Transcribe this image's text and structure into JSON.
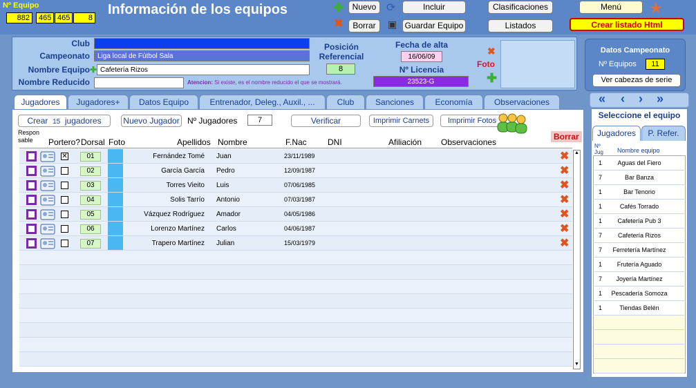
{
  "header": {
    "title": "Información de los equipos",
    "equipo_label": "Nº Equipo",
    "equipo_vals": [
      "882",
      "465",
      "465",
      "8"
    ]
  },
  "toolbar": {
    "nuevo": "Nuevo",
    "incluir": "Incluir",
    "clasificaciones": "Clasificaciones",
    "menu": "Menú",
    "borrar": "Borrar",
    "guardar": "Guardar Equipo",
    "listados": "Listados",
    "crear_html": "Crear listado Html"
  },
  "form": {
    "club_label": "Club",
    "club_value": "",
    "campeonato_label": "Campeonato",
    "campeonato_value": "Liga local de Fútbol Sala",
    "nombre_label": "Nombre Equipo",
    "nombre_value": "Cafetería Rizos",
    "reducido_label": "Nombre Reducido",
    "reducido_value": "",
    "atencion_bold": "Atencion:",
    "atencion_text": "Si existe, es el nombre reducido el que se mostrará.",
    "posicion_label": "Posición Referencial",
    "posicion_value": "8",
    "fecha_label": "Fecha de alta",
    "fecha_value": "16/06/09",
    "licencia_label": "Nº Licencia",
    "licencia_value": "23523-G",
    "foto_label": "Foto"
  },
  "campeonato_panel": {
    "title": "Datos Campeonato",
    "equipos_label": "Nº Equipos",
    "equipos_value": "11",
    "ver_cabezas": "Ver cabezas de serie"
  },
  "tabs": [
    "Jugadores",
    "Jugadores+",
    "Datos Equipo",
    "Entrenador, Deleg., Auxil., ...",
    "Club",
    "Sanciones",
    "Economía",
    "Observaciones"
  ],
  "players_toolbar": {
    "crear": "Crear",
    "crear_count": "15",
    "jugadores": "jugadores",
    "nuevo_jugador": "Nuevo Jugador",
    "n_jugadores_label": "Nº Jugadores",
    "n_jugadores_value": "7",
    "verificar": "Verificar",
    "imprimir_carnets": "Imprimir Carnets",
    "imprimir_fotos": "Imprimir Fotos",
    "borrar": "Borrar"
  },
  "columns": {
    "responsable": "Respon sable",
    "portero": "Portero?",
    "dorsal": "Dorsal",
    "foto": "Foto",
    "apellidos": "Apellidos",
    "nombre": "Nombre",
    "fnac": "F.Nac",
    "dni": "DNI",
    "afiliacion": "Afiliación",
    "observaciones": "Observaciones"
  },
  "players": [
    {
      "portero": true,
      "dorsal": "01",
      "apellidos": "Fernández Tomé",
      "nombre": "Juan",
      "fnac": "23/11/1989"
    },
    {
      "portero": false,
      "dorsal": "02",
      "apellidos": "García García",
      "nombre": "Pedro",
      "fnac": "12/09/1987"
    },
    {
      "portero": false,
      "dorsal": "03",
      "apellidos": "Torres Vieito",
      "nombre": "Luis",
      "fnac": "07/06/1985"
    },
    {
      "portero": false,
      "dorsal": "04",
      "apellidos": "Solis Tarrío",
      "nombre": "Antonio",
      "fnac": "07/03/1987"
    },
    {
      "portero": false,
      "dorsal": "05",
      "apellidos": "Vázquez Rodríguez",
      "nombre": "Amador",
      "fnac": "04/05/1986"
    },
    {
      "portero": false,
      "dorsal": "06",
      "apellidos": "Lorenzo Martínez",
      "nombre": "Carlos",
      "fnac": "04/06/1987"
    },
    {
      "portero": false,
      "dorsal": "07",
      "apellidos": "Trapero Martínez",
      "nombre": "Julian",
      "fnac": "15/03/1979"
    }
  ],
  "side": {
    "title": "Seleccione el equipo",
    "tab1": "Jugadores",
    "tab2": "P. Refer.",
    "col1": "Nº Jug",
    "col2": "Nombre equipo",
    "teams": [
      {
        "n": "1",
        "name": "Aguas del Fiero"
      },
      {
        "n": "7",
        "name": "Bar Banza"
      },
      {
        "n": "1",
        "name": "Bar Tenorio"
      },
      {
        "n": "1",
        "name": "Cafés Torrado"
      },
      {
        "n": "1",
        "name": "Cafetería Pub 3"
      },
      {
        "n": "7",
        "name": "Cafetería Rizos"
      },
      {
        "n": "7",
        "name": "Ferretería Martínez"
      },
      {
        "n": "1",
        "name": "Frutería Aguado"
      },
      {
        "n": "7",
        "name": "Joyería Martínez"
      },
      {
        "n": "1",
        "name": "Pescadería Somoza"
      },
      {
        "n": "1",
        "name": "Tiendas Belén"
      }
    ]
  }
}
